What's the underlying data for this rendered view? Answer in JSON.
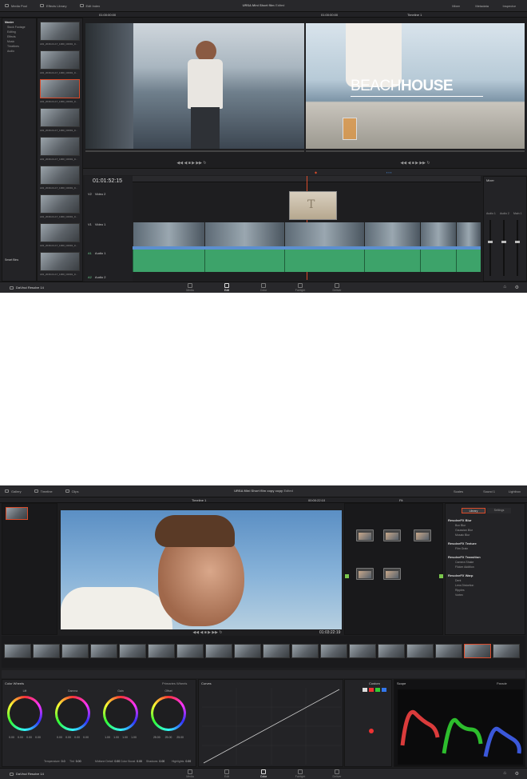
{
  "edit": {
    "top_tabs": [
      "Media Pool",
      "Effects Library",
      "Edit Index"
    ],
    "project_title": "URSA Mini Short film",
    "project_status": "Edited",
    "right_tabs": [
      "Mixer",
      "Metadata",
      "Inspector"
    ],
    "source_tc": "01:00:00:00",
    "record_tc": "01:00:00:00",
    "timeline_name": "Timeline 1",
    "timecode": "01:01:52:15",
    "bins": [
      "Master",
      "Stock Footage",
      "Editing",
      "Effects",
      "Music",
      "Timelines",
      "Audio"
    ],
    "smart_bins_label": "Smart Bins",
    "clip_name": "A01_2016-01-17_1000_C0001_0...",
    "title_overlay_a": "BEACH",
    "title_overlay_b": "HOUSE",
    "track_labels": [
      {
        "id": "V2",
        "name": "Video 2"
      },
      {
        "id": "V1",
        "name": "Video 1"
      },
      {
        "id": "A1",
        "name": "Audio 1"
      },
      {
        "id": "A2",
        "name": "Audio 2"
      }
    ],
    "mixer_title": "Mixer",
    "mixer_channels": [
      "Audio 1",
      "Audio 2",
      "Main 1"
    ],
    "app_name": "DaVinci Resolve 14",
    "pages": [
      "Media",
      "Edit",
      "Color",
      "Fairlight",
      "Deliver"
    ],
    "active_page": "Edit"
  },
  "color": {
    "top_tabs": [
      "Gallery",
      "Timeline",
      "Clips"
    ],
    "project_title": "URSA Mini Short film copy copy",
    "project_status": "Edited",
    "right_tabs": [
      "Scales",
      "Sound 1",
      "Lightbox"
    ],
    "timeline_name": "Timeline 1",
    "clip_tc": "00:00:22:10",
    "viewer_tc": "01:03:22:19",
    "fit_label": "Fit",
    "library_tabs": [
      "Library",
      "Settings"
    ],
    "library_sections": [
      {
        "title": "ResolveFX Blur",
        "items": [
          "Box Blur",
          "Gaussian Blur",
          "Mosaic Blur"
        ]
      },
      {
        "title": "ResolveFX Texture",
        "items": [
          "Film Grain"
        ]
      },
      {
        "title": "ResolveFX Transition",
        "items": [
          "Camera Shake",
          "Flicker Addition"
        ]
      },
      {
        "title": "ResolveFX Warp",
        "items": [
          "Dent",
          "Lens Distortion",
          "Ripples",
          "Vortex"
        ]
      }
    ],
    "color_wheels_title": "Color Wheels",
    "primaries_title": "Primaries Wheels",
    "wheels": [
      {
        "name": "Lift",
        "values": [
          "0.00",
          "0.00",
          "0.00",
          "0.00"
        ]
      },
      {
        "name": "Gamma",
        "values": [
          "0.00",
          "0.00",
          "0.00",
          "0.00"
        ]
      },
      {
        "name": "Gain",
        "values": [
          "1.00",
          "1.00",
          "1.00",
          "1.00"
        ]
      },
      {
        "name": "Offset",
        "values": [
          "25.00",
          "25.00",
          "25.00"
        ]
      }
    ],
    "adjust": [
      {
        "name": "Temperature",
        "value": "0.0"
      },
      {
        "name": "Tint",
        "value": "0.00"
      },
      {
        "name": "Midtone Detail",
        "value": "0.00"
      },
      {
        "name": "Color Boost",
        "value": "0.00"
      },
      {
        "name": "Shadows",
        "value": "0.00"
      },
      {
        "name": "Highlights",
        "value": "0.00"
      }
    ],
    "curves_title": "Curves",
    "custom_label": "Custom",
    "scope_title": "Scope",
    "scope_mode": "Parade",
    "app_name": "DaVinci Resolve 14",
    "pages": [
      "Media",
      "Edit",
      "Color",
      "Fairlight",
      "Deliver"
    ],
    "active_page": "Color",
    "accent": "#d94b2a"
  }
}
